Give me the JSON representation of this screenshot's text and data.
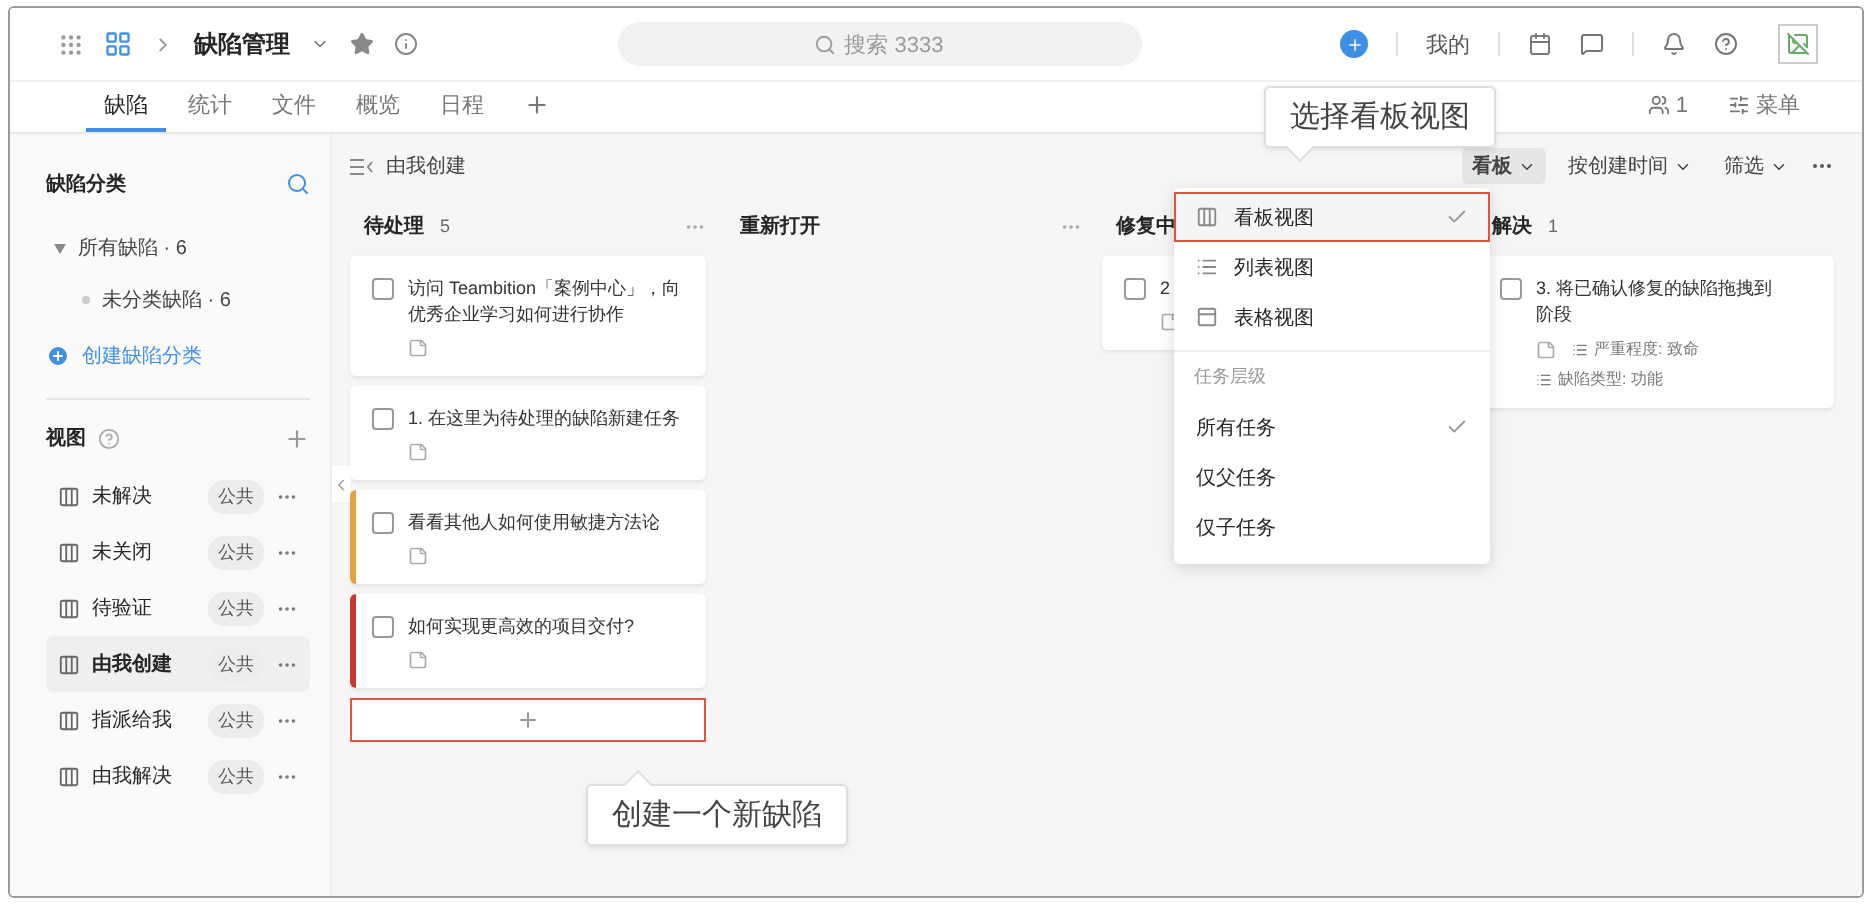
{
  "topbar": {
    "title": "缺陷管理",
    "search": {
      "placeholder": "搜索 3333"
    },
    "link": "我的"
  },
  "tabs": [
    {
      "label": "缺陷",
      "selected": true
    },
    {
      "label": "统计",
      "selected": false
    },
    {
      "label": "文件",
      "selected": false
    },
    {
      "label": "概览",
      "selected": false
    },
    {
      "label": "日程",
      "selected": false
    }
  ],
  "tab_actions": {
    "members": "1",
    "menu": "菜单"
  },
  "sidebar": {
    "heading": "缺陷分类",
    "tree": [
      {
        "label": "所有缺陷 · 6",
        "expanded": true,
        "children": [
          {
            "label": "未分类缺陷 · 6"
          }
        ]
      }
    ],
    "create_link": "创建缺陷分类",
    "views_heading": "视图",
    "views": [
      {
        "label": "未解决",
        "badge": "公共",
        "selected": false
      },
      {
        "label": "未关闭",
        "badge": "公共",
        "selected": false
      },
      {
        "label": "待验证",
        "badge": "公共",
        "selected": false
      },
      {
        "label": "由我创建",
        "badge": "公共",
        "selected": true
      },
      {
        "label": "指派给我",
        "badge": "公共",
        "selected": false
      },
      {
        "label": "由我解决",
        "badge": "公共",
        "selected": false
      }
    ]
  },
  "board": {
    "title": "由我创建",
    "controls": [
      {
        "label": "看板",
        "selected": true
      },
      {
        "label": "按创建时间",
        "selected": false
      },
      {
        "label": "筛选",
        "selected": false
      }
    ],
    "columns": [
      {
        "title": "待处理",
        "count": "5",
        "more_menu": true,
        "add_button": {
          "highlighted": true
        },
        "cards": [
          {
            "title": "访问 Teambition「案例中心」，向优秀企业学习如何进行协作",
            "checked": false
          },
          {
            "title": "1. 在这里为待处理的缺陷新建任务",
            "checked": false
          },
          {
            "title": "看看其他人如何使用敏捷方法论",
            "checked": false,
            "color": "#e8a040"
          },
          {
            "title": "如何实现更高效的项目交付?",
            "checked": false,
            "color": "#c8372d"
          }
        ]
      },
      {
        "title": "重新打开",
        "more_menu": true
      },
      {
        "title": "修复中",
        "cards": [
          {
            "title": "2",
            "checked": false
          }
        ]
      },
      {
        "title": "解决",
        "count": "1",
        "cards": [
          {
            "lines": [
              "3. 将已确认修复的缺陷拖拽到",
              "阶段"
            ],
            "checked": false,
            "fields": [
              "严重程度: 致命",
              "缺陷类型: 功能"
            ]
          }
        ]
      }
    ]
  },
  "dropdown": {
    "items": [
      {
        "kind": "board",
        "label": "看板视图",
        "selected": true,
        "highlighted": true
      },
      {
        "kind": "list",
        "label": "列表视图",
        "selected": false,
        "highlighted": false
      },
      {
        "kind": "table",
        "label": "表格视图",
        "selected": false,
        "highlighted": false
      }
    ],
    "section": "任务层级",
    "levels": [
      {
        "label": "所有任务",
        "selected": true
      },
      {
        "label": "仅父任务",
        "selected": false
      },
      {
        "label": "仅子任务",
        "selected": false
      }
    ]
  },
  "callouts": {
    "view_hint": "选择看板视图",
    "add_hint": "创建一个新缺陷"
  }
}
